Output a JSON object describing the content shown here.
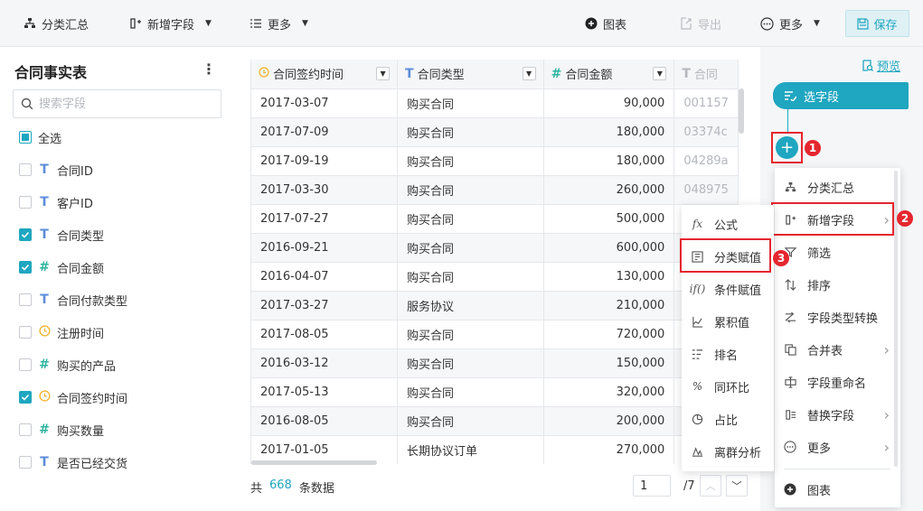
{
  "toolbar": {
    "group_summary": "分类汇总",
    "new_field": "新增字段",
    "more_left": "更多",
    "chart": "图表",
    "export": "导出",
    "more_right": "更多",
    "save": "保存"
  },
  "left_panel": {
    "title": "合同事实表",
    "search_placeholder": "搜索字段",
    "select_all": "全选",
    "fields": [
      {
        "name": "合同ID",
        "type": "text",
        "checked": false
      },
      {
        "name": "客户ID",
        "type": "text",
        "checked": false
      },
      {
        "name": "合同类型",
        "type": "text",
        "checked": true
      },
      {
        "name": "合同金额",
        "type": "number",
        "checked": true
      },
      {
        "name": "合同付款类型",
        "type": "text",
        "checked": false
      },
      {
        "name": "注册时间",
        "type": "date",
        "checked": false
      },
      {
        "name": "购买的产品",
        "type": "number",
        "checked": false
      },
      {
        "name": "合同签约时间",
        "type": "date",
        "checked": true
      },
      {
        "name": "购买数量",
        "type": "number",
        "checked": false
      },
      {
        "name": "是否已经交货",
        "type": "text",
        "checked": false
      }
    ]
  },
  "table": {
    "columns": [
      "合同签约时间",
      "合同类型",
      "合同金额",
      "合同"
    ],
    "rows": [
      [
        "2017-03-07",
        "购买合同",
        "90,000",
        "001157"
      ],
      [
        "2017-07-09",
        "购买合同",
        "180,000",
        "03374c"
      ],
      [
        "2017-09-19",
        "购买合同",
        "180,000",
        "04289a"
      ],
      [
        "2017-03-30",
        "购买合同",
        "260,000",
        "048975"
      ],
      [
        "2017-07-27",
        "购买合同",
        "500,000",
        ""
      ],
      [
        "2016-09-21",
        "购买合同",
        "600,000",
        ""
      ],
      [
        "2016-04-07",
        "购买合同",
        "130,000",
        ""
      ],
      [
        "2017-03-27",
        "服务协议",
        "210,000",
        ""
      ],
      [
        "2017-08-05",
        "购买合同",
        "720,000",
        ""
      ],
      [
        "2016-03-12",
        "购买合同",
        "150,000",
        ""
      ],
      [
        "2017-05-13",
        "购买合同",
        "320,000",
        ""
      ],
      [
        "2016-08-05",
        "购买合同",
        "200,000",
        ""
      ],
      [
        "2017-01-05",
        "长期协议订单",
        "270,000",
        ""
      ]
    ]
  },
  "footer": {
    "prefix": "共",
    "count": "668",
    "suffix": "条数据",
    "page": "1",
    "total_pages": "/7"
  },
  "flow": {
    "preview": "预览",
    "node_label": "选字段",
    "plus": "+",
    "badges": [
      "1",
      "2",
      "3"
    ]
  },
  "menu": {
    "items": [
      {
        "label": "分类汇总",
        "icon": "group-icon",
        "arrow": false
      },
      {
        "label": "新增字段",
        "icon": "add-field-icon",
        "arrow": true
      },
      {
        "label": "筛选",
        "icon": "filter-icon",
        "arrow": false
      },
      {
        "label": "排序",
        "icon": "sort-icon",
        "arrow": false
      },
      {
        "label": "字段类型转换",
        "icon": "convert-icon",
        "arrow": false
      },
      {
        "label": "合并表",
        "icon": "merge-icon",
        "arrow": true
      },
      {
        "label": "字段重命名",
        "icon": "rename-icon",
        "arrow": false
      },
      {
        "label": "替换字段",
        "icon": "replace-icon",
        "arrow": true
      },
      {
        "label": "更多",
        "icon": "more-icon",
        "arrow": true
      },
      {
        "label": "图表",
        "icon": "chart-icon",
        "arrow": false
      }
    ]
  },
  "submenu": {
    "items": [
      {
        "label": "公式",
        "icon": "formula-icon"
      },
      {
        "label": "分类赋值",
        "icon": "category-assign-icon"
      },
      {
        "label": "条件赋值",
        "icon": "condition-assign-icon"
      },
      {
        "label": "累积值",
        "icon": "cumulative-icon"
      },
      {
        "label": "排名",
        "icon": "rank-icon"
      },
      {
        "label": "同环比",
        "icon": "yoy-icon"
      },
      {
        "label": "占比",
        "icon": "proportion-icon"
      },
      {
        "label": "离群分析",
        "icon": "outlier-icon"
      }
    ]
  },
  "colors": {
    "accent": "#1fa6c0",
    "highlight": "#e5262e",
    "text_type": "#5d8dd9",
    "number_type": "#2fb4a1",
    "date_type": "#f3b530"
  }
}
